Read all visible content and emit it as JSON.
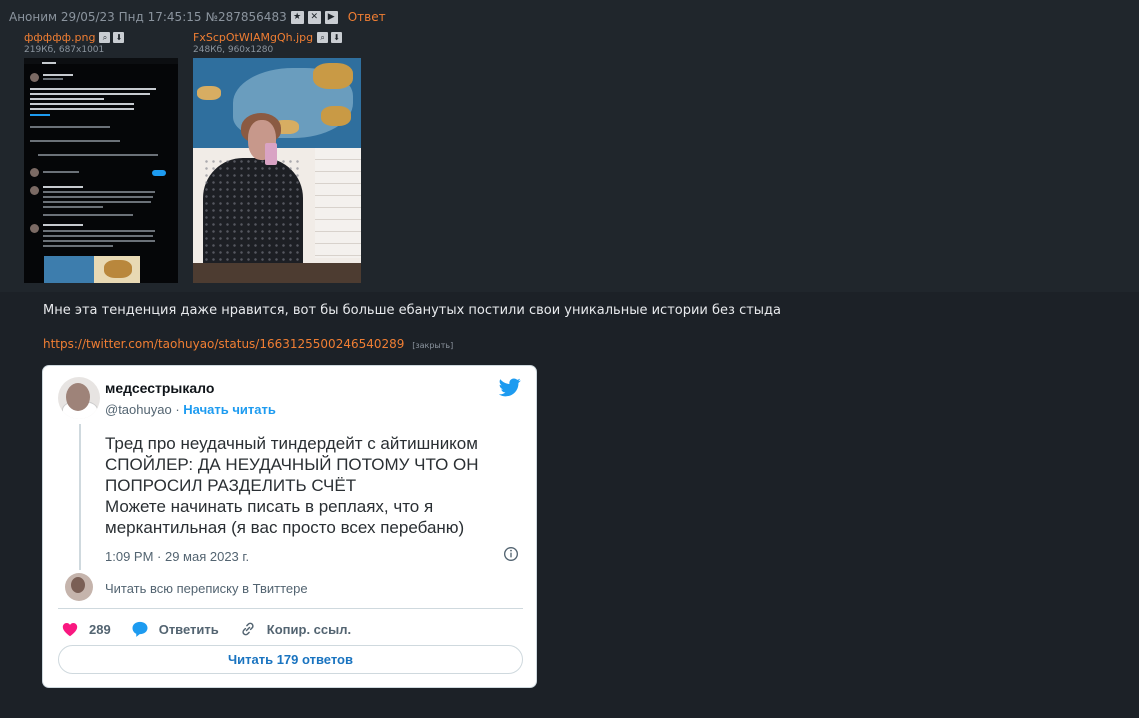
{
  "post": {
    "author": "Аноним",
    "date": "29/05/23 Пнд 17:45:15",
    "number": "№287856483",
    "reply_label": "Ответ",
    "icons": [
      "star-icon",
      "close-icon",
      "play-icon"
    ],
    "comment": "Мне эта тенденция даже нравится, вот бы больше ебанутых постили свои уникальные истории без стыда",
    "link_url": "https://twitter.com/taohuyao/status/1663125500246540289",
    "link_hide": "[закрыть]"
  },
  "files": [
    {
      "name": "ффффф.png",
      "info": "219Кб, 687x1001"
    },
    {
      "name": "FxScpOtWIAMgQh.jpg",
      "info": "248Кб, 960x1280"
    }
  ],
  "tweet": {
    "name": "медсестрыкало",
    "handle": "@taohuyao",
    "dot": "·",
    "follow": "Начать читать",
    "lines": [
      "Тред про неудачный тиндердейт с айтишником",
      "СПОЙЛЕР: ДА НЕУДАЧНЫЙ ПОТОМУ ЧТО ОН",
      "ПОПРОСИЛ РАЗДЕЛИТЬ СЧЁТ",
      "Можете начинать писать в реплаях, что я",
      "меркантильная (я вас просто всех перебаню)"
    ],
    "time": "1:09 PM · 29 мая 2023 г.",
    "read_all": "Читать всю переписку в Твиттере",
    "likes": "289",
    "reply_label": "Ответить",
    "copy_label": "Копир. ссыл.",
    "read_replies": "Читать 179 ответов"
  }
}
